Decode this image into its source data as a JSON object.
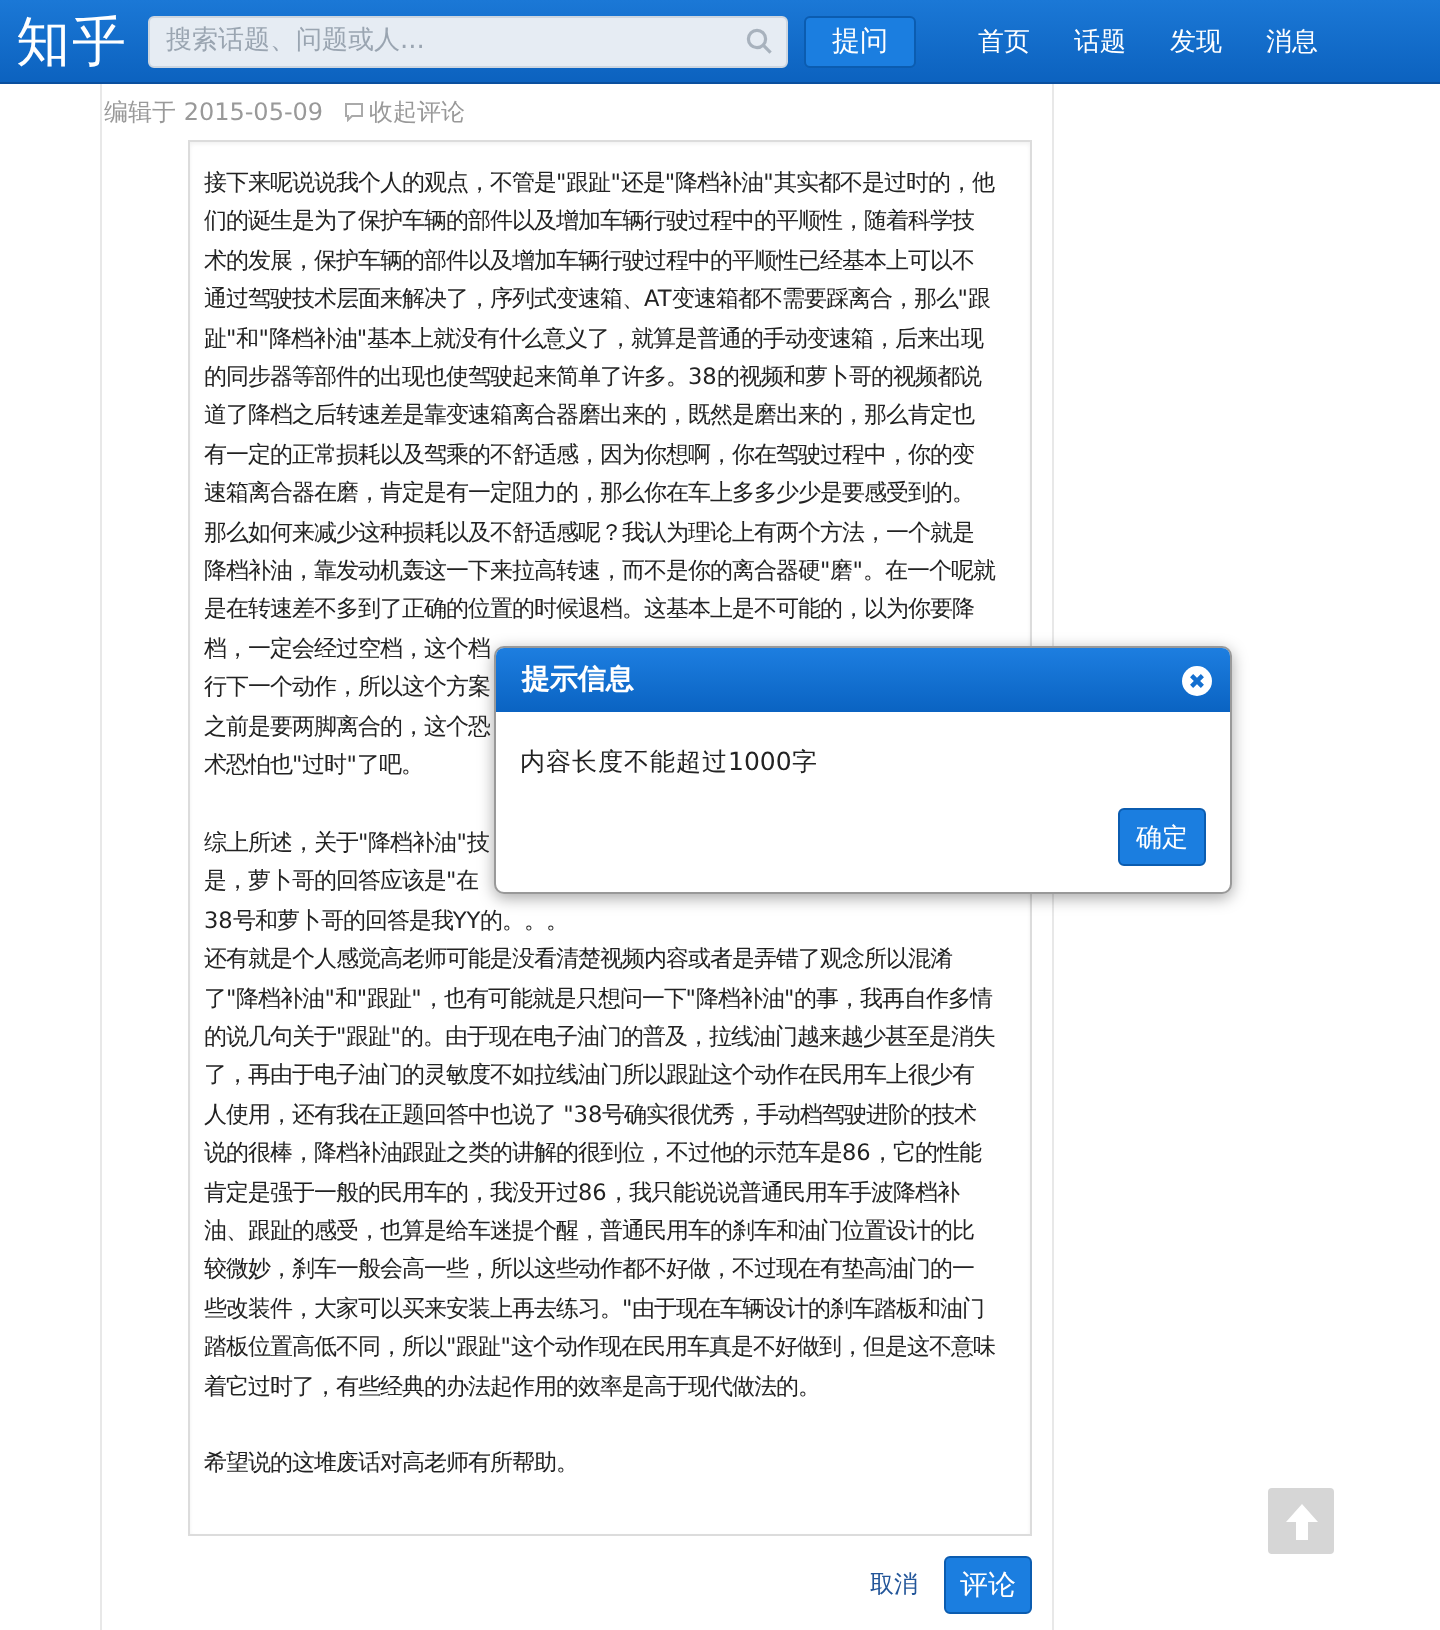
{
  "header": {
    "logo": "知乎",
    "search": {
      "placeholder": "搜索话题、问题或人..."
    },
    "ask_button": "提问",
    "nav": [
      {
        "label": "首页"
      },
      {
        "label": "话题"
      },
      {
        "label": "发现"
      },
      {
        "label": "消息"
      }
    ]
  },
  "meta": {
    "edited": "编辑于 2015-05-09",
    "collapse_comments": "收起评论"
  },
  "editor": {
    "paragraphs": [
      {
        "lines": [
          "接下来呢说说我个人的观点，不管是\"跟趾\"还是\"降档补油\"其实都不是过时的，他",
          "们的诞生是为了保护车辆的部件以及增加车辆行驶过程中的平顺性，随着科学技",
          "术的发展，保护车辆的部件以及增加车辆行驶过程中的平顺性已经基本上可以不",
          "通过驾驶技术层面来解决了，序列式变速箱、AT变速箱都不需要踩离合，那么\"跟",
          "趾\"和\"降档补油\"基本上就没有什么意义了，就算是普通的手动变速箱，后来出现",
          "的同步器等部件的出现也使驾驶起来简单了许多。38的视频和萝卜哥的视频都说",
          "道了降档之后转速差是靠变速箱离合器磨出来的，既然是磨出来的，那么肯定也",
          "有一定的正常损耗以及驾乘的不舒适感，因为你想啊，你在驾驶过程中，你的变",
          "速箱离合器在磨，肯定是有一定阻力的，那么你在车上多多少少是要感受到的。",
          "那么如何来减少这种损耗以及不舒适感呢？我认为理论上有两个方法，一个就是",
          "降档补油，靠发动机轰这一下来拉高转速，而不是你的离合器硬\"磨\"。在一个呢就",
          "是在转速差不多到了正确的位置的时候退档。这基本上是不可能的，以为你要降",
          "档，一定会经过空档，这个档",
          "行下一个动作，所以这个方案",
          "之前是要两脚离合的，这个恐",
          "术恐怕也\"过时\"了吧。"
        ]
      },
      {
        "lines": [
          "综上所述，关于\"降档补油\"技",
          "是，萝卜哥的回答应该是\"在",
          "38号和萝卜哥的回答是我YY的。。。",
          "还有就是个人感觉高老师可能是没看清楚视频内容或者是弄错了观念所以混淆",
          "了\"降档补油\"和\"跟趾\"，也有可能就是只想问一下\"降档补油\"的事，我再自作多情",
          "的说几句关于\"跟趾\"的。由于现在电子油门的普及，拉线油门越来越少甚至是消失",
          "了，再由于电子油门的灵敏度不如拉线油门所以跟趾这个动作在民用车上很少有",
          "人使用，还有我在正题回答中也说了 \"38号确实很优秀，手动档驾驶进阶的技术",
          "说的很棒，降档补油跟趾之类的讲解的很到位，不过他的示范车是86，它的性能",
          "肯定是强于一般的民用车的，我没开过86，我只能说说普通民用车手波降档补",
          "油、跟趾的感受，也算是给车迷提个醒，普通民用车的刹车和油门位置设计的比",
          "较微妙，刹车一般会高一些，所以这些动作都不好做，不过现在有垫高油门的一",
          "些改装件，大家可以买来安装上再去练习。\"由于现在车辆设计的刹车踏板和油门",
          "踏板位置高低不同，所以\"跟趾\"这个动作现在民用车真是不好做到，但是这不意味",
          "着它过时了，有些经典的办法起作用的效率是高于现代做法的。"
        ]
      },
      {
        "lines": [
          "希望说的这堆废话对高老师有所帮助。"
        ]
      }
    ]
  },
  "actions": {
    "cancel": "取消",
    "submit": "评论"
  },
  "dialog": {
    "title": "提示信息",
    "message": "内容长度不能超过1000字",
    "confirm": "确定"
  }
}
